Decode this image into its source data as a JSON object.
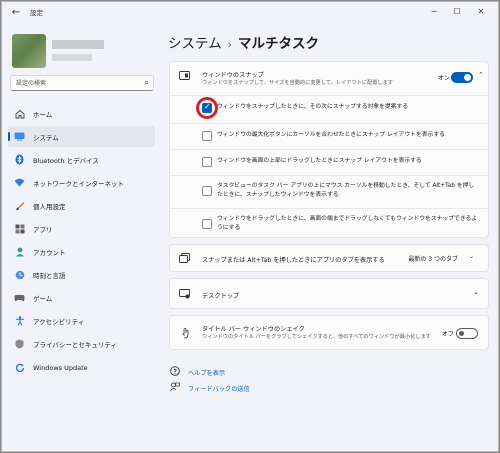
{
  "window": {
    "title": "設定",
    "back_icon": "back-arrow-icon",
    "minimize_glyph": "─",
    "maximize_glyph": "☐",
    "close_glyph": "✕"
  },
  "search": {
    "placeholder": "設定の検索"
  },
  "breadcrumb": {
    "parent": "システム",
    "separator": "›",
    "current": "マルチタスク"
  },
  "sidebar": {
    "items": [
      {
        "label": "ホーム",
        "icon": "home-icon",
        "active": false
      },
      {
        "label": "システム",
        "icon": "system-icon",
        "active": true
      },
      {
        "label": "Bluetooth とデバイス",
        "icon": "bluetooth-icon",
        "active": false
      },
      {
        "label": "ネットワークとインターネット",
        "icon": "network-icon",
        "active": false
      },
      {
        "label": "個人用設定",
        "icon": "personalization-icon",
        "active": false
      },
      {
        "label": "アプリ",
        "icon": "apps-icon",
        "active": false
      },
      {
        "label": "アカウント",
        "icon": "account-icon",
        "active": false
      },
      {
        "label": "時刻と言語",
        "icon": "time-language-icon",
        "active": false
      },
      {
        "label": "ゲーム",
        "icon": "gaming-icon",
        "active": false
      },
      {
        "label": "アクセシビリティ",
        "icon": "accessibility-icon",
        "active": false
      },
      {
        "label": "プライバシーとセキュリティ",
        "icon": "privacy-icon",
        "active": false
      },
      {
        "label": "Windows Update",
        "icon": "windows-update-icon",
        "active": false
      }
    ]
  },
  "snap": {
    "title": "ウィンドウのスナップ",
    "subtitle": "ウィンドウをスナップして、サイズを自動的に変更して、レイアウトに配置します",
    "toggle_label": "オン",
    "toggle_on": true,
    "options": [
      {
        "text": "ウィンドウをスナップしたときに、その次にスナップする対象を提案する",
        "checked": true
      },
      {
        "text": "ウィンドウの最大化ボタンにカーソルを合わせたときにスナップ レイアウトを表示する",
        "checked": false
      },
      {
        "text": "ウィンドウを画面の上部にドラッグしたときにスナップ レイアウトを表示する",
        "checked": false
      },
      {
        "text": "タスクビューのタスク バー アプリの上にマウス カーソルを移動したとき、そして Alt+Tab を押したときに、スナップしたウィンドウを表示する",
        "checked": false
      },
      {
        "text": "ウィンドウをドラッグしたときに、画面の端までドラッグしなくてもウィンドウをスナップできるようにする",
        "checked": false
      }
    ]
  },
  "alt_tab": {
    "title": "スナップまたは Alt+Tab を押したときにアプリのタブを表示する",
    "value": "最新の 3 つのタブ"
  },
  "desktops": {
    "title": "デスクトップ"
  },
  "shake": {
    "title": "タイトル バー ウィンドウのシェイク",
    "subtitle": "ウィンドウのタイトル バーをグラブしてシェイクすると、他のすべてのウィンドウが最小化します",
    "toggle_label": "オフ",
    "toggle_on": false
  },
  "links": {
    "help": "ヘルプを表示",
    "feedback": "フィードバックの送信"
  },
  "colors": {
    "accent": "#005fb8",
    "highlight_ring": "#d0222f",
    "link": "#0b5cad"
  }
}
